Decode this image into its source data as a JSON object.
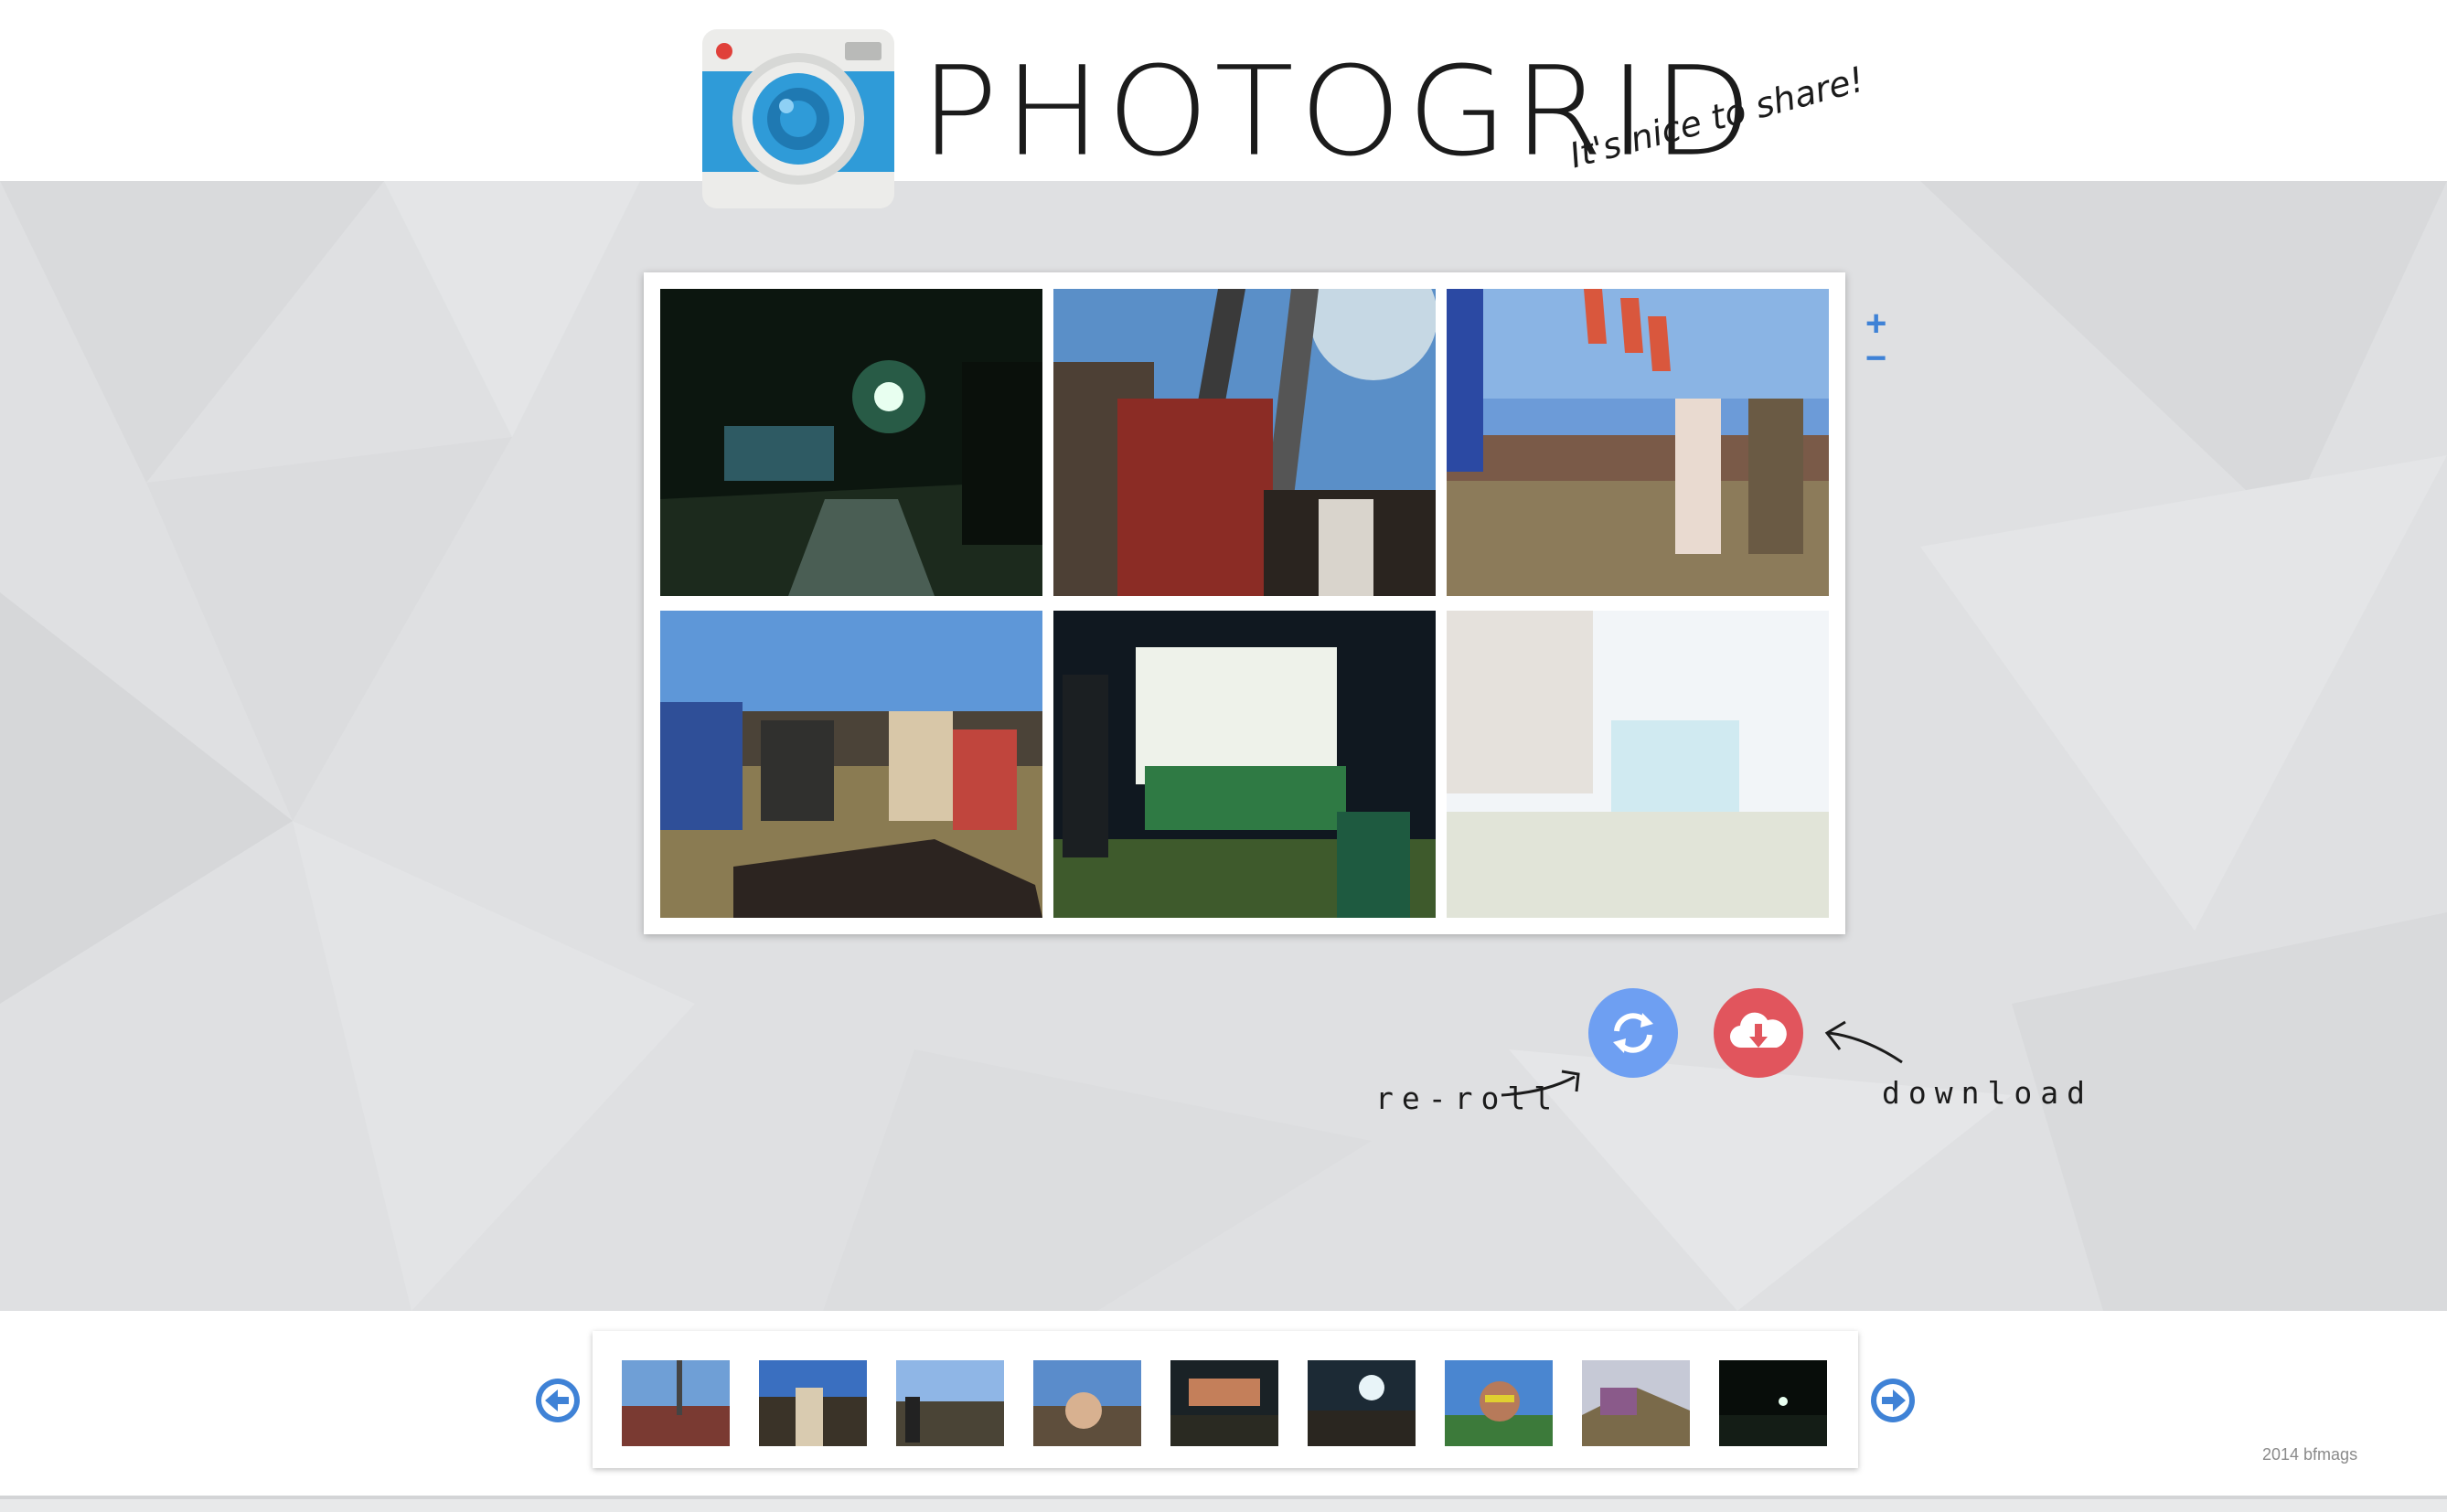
{
  "header": {
    "logo_text": "PHOTOGRID",
    "tagline": "It's nice to share!",
    "logo_icon": "camera-icon"
  },
  "zoom": {
    "in_label": "+",
    "out_label": "−"
  },
  "grid": {
    "tiles": [
      {
        "scene": "night-lamp"
      },
      {
        "scene": "crowd-stage-sun"
      },
      {
        "scene": "festival-flags"
      },
      {
        "scene": "sitting-crowd"
      },
      {
        "scene": "food-stall-night"
      },
      {
        "scene": "faded-placeholder"
      }
    ]
  },
  "actions": {
    "reroll_label": "re-roll",
    "download_label": "download",
    "reroll_icon": "refresh-icon",
    "download_icon": "cloud-download-icon",
    "reroll_color": "#6e9ff2",
    "download_color": "#e1555d"
  },
  "strip": {
    "prev_icon": "arrow-left-icon",
    "next_icon": "arrow-right-icon",
    "accent": "#3f82d6",
    "thumbnail_count": 9
  },
  "footer": {
    "credit": "2014 bfmags"
  }
}
